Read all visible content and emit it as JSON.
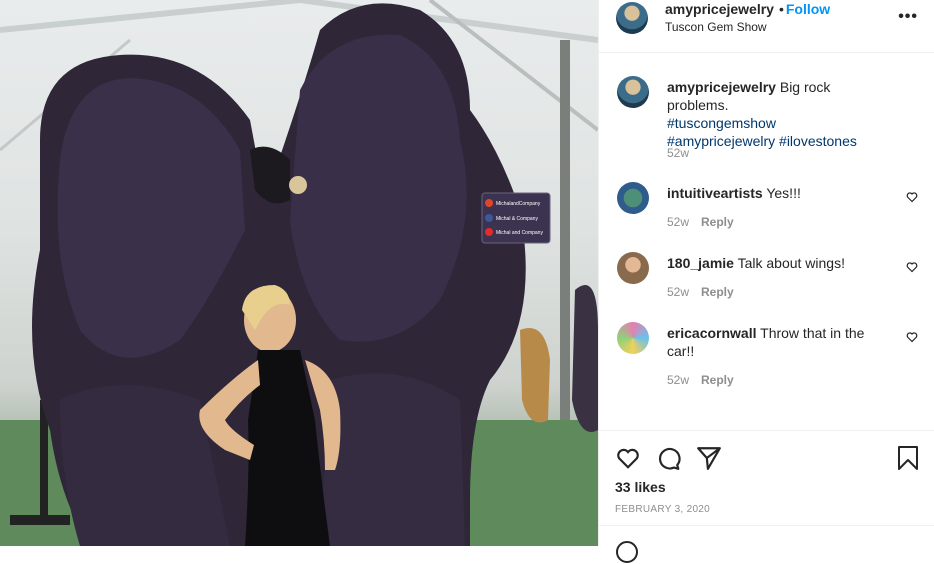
{
  "post": {
    "username": "amypricejewelry",
    "follow_label": "Follow",
    "location": "Tuscon Gem Show",
    "caption_user": "amypricejewelry",
    "caption_text": "Big rock problems.",
    "hashtags": "#tuscongemshow #amypricejewelry #ilovestones",
    "caption_time": "52w",
    "likes": "33 likes",
    "date": "FEBRUARY 3, 2020"
  },
  "photo": {
    "sign_lines": [
      "MichalandCompany",
      "Michal & Company",
      "Michal and Company"
    ]
  },
  "comments": [
    {
      "user": "intuitiveartists",
      "text": "Yes!!!",
      "time": "52w",
      "reply": "Reply"
    },
    {
      "user": "180_jamie",
      "text": "Talk about wings!",
      "time": "52w",
      "reply": "Reply"
    },
    {
      "user": "ericacornwall",
      "text": "Throw that in the car!!",
      "time": "52w",
      "reply": "Reply"
    }
  ],
  "icons": [
    "heart-icon",
    "comment-icon",
    "share-icon",
    "bookmark-icon",
    "more-icon"
  ]
}
